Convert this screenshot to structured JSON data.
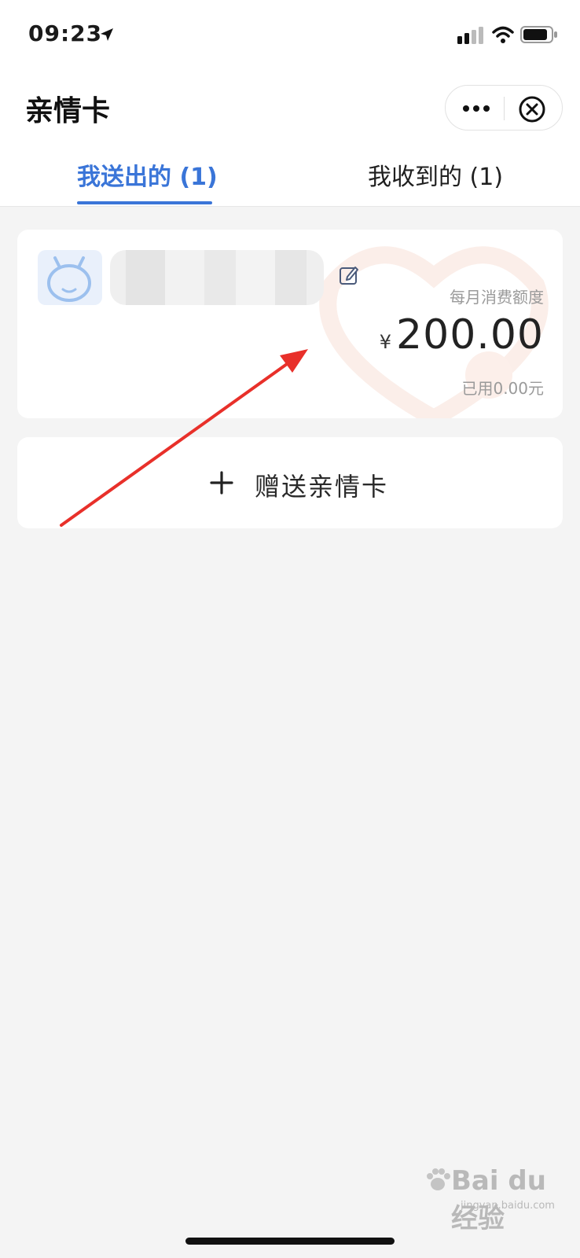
{
  "status_bar": {
    "time": "09:23"
  },
  "header": {
    "title": "亲情卡",
    "capsule_icons": [
      "more-icon",
      "close-mini-icon"
    ]
  },
  "tabs": [
    {
      "label": "我送出的 (1)",
      "active": true
    },
    {
      "label": "我收到的 (1)",
      "active": false
    }
  ],
  "card": {
    "quota_label": "每月消费额度",
    "currency": "¥",
    "amount": "200.00",
    "used": "已用0.00元"
  },
  "gift_button": {
    "label": "赠送亲情卡"
  },
  "watermark": {
    "text": "Bai du 经验",
    "domain": "jingyan.baidu.com"
  },
  "colors": {
    "accent": "#3a75d8",
    "background": "#f4f4f4",
    "annotation": "#e8302a"
  }
}
